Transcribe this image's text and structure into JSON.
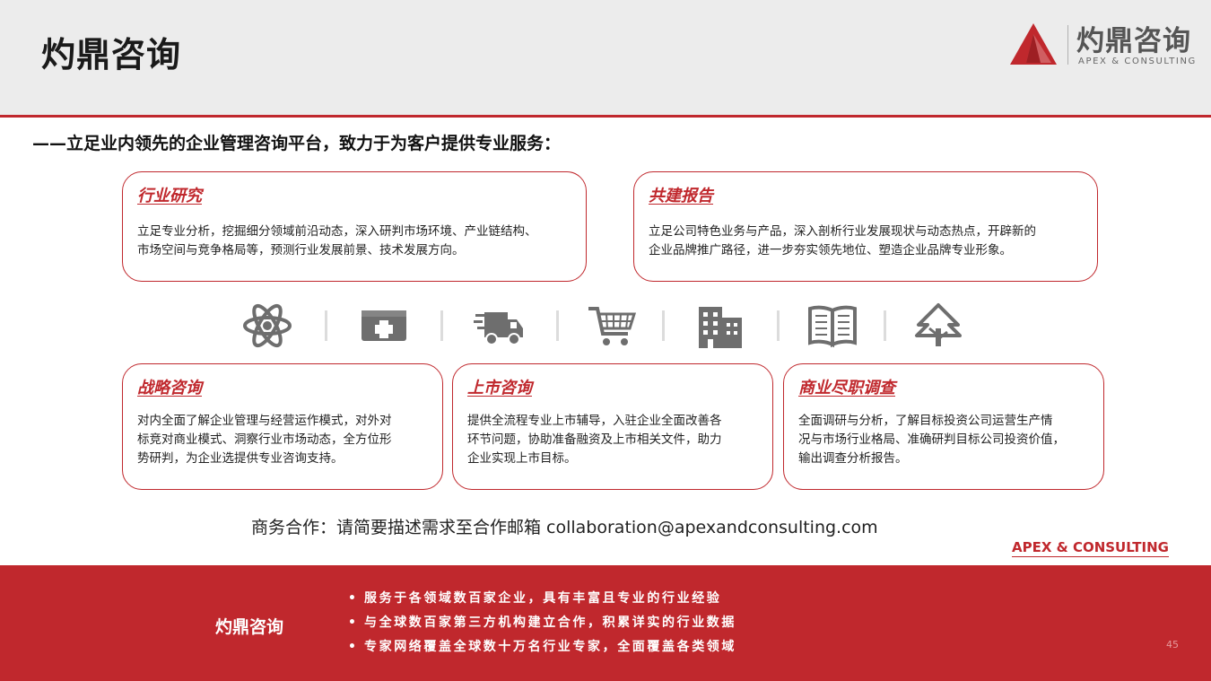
{
  "header": {
    "title": "灼鼎咨询",
    "logo_cn": "灼鼎咨询",
    "logo_en": "APEX & CONSULTING"
  },
  "tagline": "——立足业内领先的企业管理咨询平台，致力于为客户提供专业服务：",
  "cards": [
    {
      "title": "行业研究",
      "lines": [
        "立足专业分析，挖掘细分领域前沿动态，深入研判市场环境、产业链结构、",
        "市场空间与竞争格局等，预测行业发展前景、技术发展方向。"
      ]
    },
    {
      "title": "共建报告",
      "lines": [
        "立足公司特色业务与产品，深入剖析行业发展现状与动态热点，开辟新的",
        "企业品牌推广路径，进一步夯实领先地位、塑造企业品牌专业形象。"
      ]
    },
    {
      "title": "战略咨询",
      "lines": [
        "对内全面了解企业管理与经营运作模式，对外对",
        "标竞对商业模式、洞察行业市场动态，全方位形",
        "势研判，为企业选提供专业咨询支持。"
      ]
    },
    {
      "title": "上市咨询",
      "lines": [
        "提供全流程专业上市辅导，入驻企业全面改善各",
        "环节问题，协助准备融资及上市相关文件，助力",
        "企业实现上市目标。"
      ]
    },
    {
      "title": "商业尽职调查",
      "lines": [
        "全面调研与分析，了解目标投资公司运营生产情",
        "况与市场行业格局、准确研判目标公司投资价值，",
        "输出调查分析报告。"
      ]
    }
  ],
  "icons": [
    "atom-icon",
    "medical-kit-icon",
    "delivery-truck-icon",
    "shopping-cart-icon",
    "building-icon",
    "book-icon",
    "tree-icon"
  ],
  "contact": "商务合作：请简要描述需求至合作邮箱 collaboration@apexandconsulting.com",
  "apex_link": "APEX & CONSULTING",
  "footer": {
    "brand": "灼鼎咨询",
    "bullet": "•",
    "items": [
      "服务于各领域数百家企业，具有丰富且专业的行业经验",
      "与全球数百家第三方机构建立合作，积累详实的行业数据",
      "专家网络覆盖全球数十万名行业专家，全面覆盖各类领域"
    ],
    "page_number": "45"
  },
  "colors": {
    "accent": "#c0282d",
    "icon_gray": "#6e6e6e",
    "header_bg": "#ececec"
  }
}
